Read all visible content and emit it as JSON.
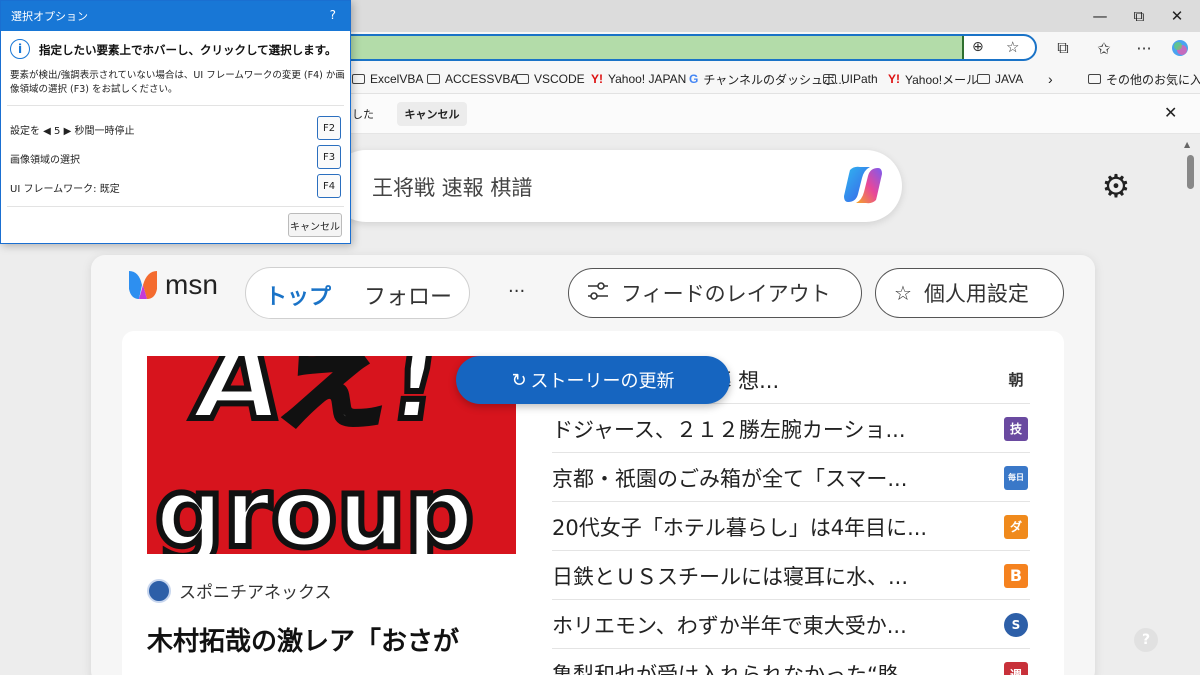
{
  "browser": {
    "window_controls": {
      "minimize": "—",
      "maximize": "⧉",
      "close": "✕"
    },
    "infobar_partial": "した",
    "infobar_cancel": "キャンセル",
    "infobar_close": "✕"
  },
  "bookmarks": [
    {
      "label": "ExcelVBA",
      "icon": "folder-icon"
    },
    {
      "label": "ACCESSVBA",
      "icon": "folder-icon"
    },
    {
      "label": "VSCODE",
      "icon": "folder-icon"
    },
    {
      "label": "Yahoo! JAPAN",
      "icon": "yahoo-icon"
    },
    {
      "label": "チャンネルのダッシュボ...",
      "icon": "google-icon"
    },
    {
      "label": "UIPath",
      "icon": "folder-icon"
    },
    {
      "label": "Yahoo!メール",
      "icon": "yahoo-icon"
    },
    {
      "label": "JAVA",
      "icon": "folder-icon"
    },
    {
      "label": "その他のお気に入り",
      "icon": "folder-icon"
    }
  ],
  "search": {
    "query": "王将戦 速報 棋譜"
  },
  "msn": {
    "logo_text": "msn",
    "tabs": {
      "top": "トップ",
      "follow": "フォロー"
    },
    "more": "···",
    "layout_button": "フィードのレイアウト",
    "personal_button": "個人用設定",
    "refresh_button": "ストーリーの更新",
    "hero": {
      "source": "スポニチアネックス",
      "headline": "木村拓哉の激レア「おさが"
    },
    "news": [
      {
        "title": "退職に1830人応募 想...",
        "badge": "朝",
        "badge_color": "#ffffff"
      },
      {
        "title": "ドジャース、２１２勝左腕カーショ...",
        "badge": "技",
        "badge_color": "#6a4aa0"
      },
      {
        "title": "京都・祇園のごみ箱が全て「スマー...",
        "badge": "毎日",
        "badge_color": "#3a78c8"
      },
      {
        "title": "20代女子「ホテル暮らし」は4年目に...",
        "badge": "ダ",
        "badge_color": "#f08a1c"
      },
      {
        "title": "日鉄とＵＳスチールには寝耳に水、...",
        "badge": "B",
        "badge_color": "#f5821f"
      },
      {
        "title": "ホリエモン、わずか半年で東大受か...",
        "badge": "S",
        "badge_color": "#2d5fa8"
      },
      {
        "title": "亀梨和也が受け入れられなかった“賂...",
        "badge": "週",
        "badge_color": "#c8313a"
      }
    ]
  },
  "dialog": {
    "title": "選択オプション",
    "help": "?",
    "heading": "指定したい要素上でホバーし、クリックして選択します。",
    "description": "要素が検出/強調表示されていない場合は、UI フレームワークの変更 (F4) か画像領域の選択 (F3) をお試しください。",
    "rows": [
      {
        "label": "設定を ◀ 5 ▶ 秒間一時停止",
        "key": "F2"
      },
      {
        "label": "画像領域の選択",
        "key": "F3"
      },
      {
        "label": "UI フレームワーク: 既定",
        "key": "F4"
      }
    ],
    "cancel": "キャンセル"
  }
}
